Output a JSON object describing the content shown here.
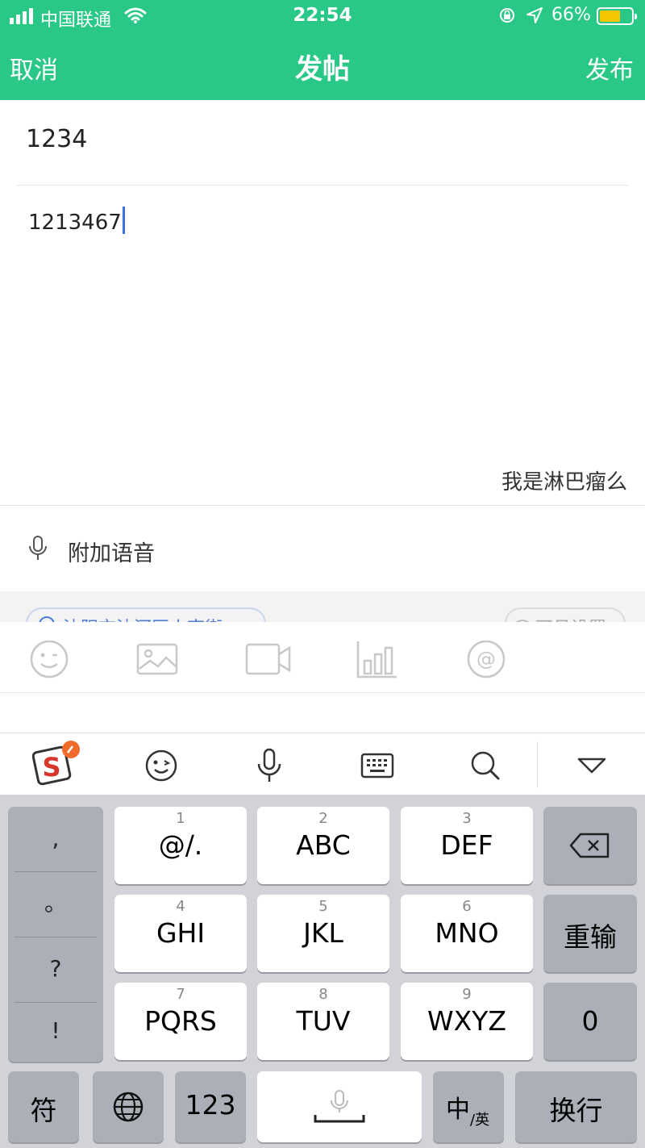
{
  "status_bar": {
    "carrier": "中国联通",
    "time": "22:54",
    "battery_percent": "66%",
    "battery_level": 0.66,
    "icons": [
      "signal-icon",
      "wifi-icon",
      "orientation-lock-icon",
      "location-arrow-icon",
      "battery-icon"
    ]
  },
  "nav": {
    "cancel": "取消",
    "title": "发帖",
    "publish": "发布"
  },
  "post": {
    "title_value": "1234",
    "body_value": "1213467"
  },
  "suggestion": "我是淋巴瘤么",
  "voice": {
    "label": "附加语音"
  },
  "location_pill": "沈阳市沈河区小南街",
  "visibility_pill": "可见设置",
  "toolbar_icons": [
    "emoji-icon",
    "image-icon",
    "video-icon",
    "chart-icon",
    "at-mention-icon"
  ],
  "keyboard": {
    "toolbar_icons": [
      "sogou-logo-icon",
      "emoji-icon",
      "microphone-icon",
      "keyboard-icon",
      "search-icon",
      "collapse-keyboard-icon"
    ],
    "punctuation": [
      ",",
      "。",
      "?",
      "!"
    ],
    "keys": [
      {
        "num": "1",
        "label": "@/."
      },
      {
        "num": "2",
        "label": "ABC"
      },
      {
        "num": "3",
        "label": "DEF"
      },
      {
        "num": "4",
        "label": "GHI"
      },
      {
        "num": "5",
        "label": "JKL"
      },
      {
        "num": "6",
        "label": "MNO"
      },
      {
        "num": "7",
        "label": "PQRS"
      },
      {
        "num": "8",
        "label": "TUV"
      },
      {
        "num": "9",
        "label": "WXYZ"
      }
    ],
    "reinput": "重输",
    "zero": "0",
    "symbols": "符",
    "num_mode": "123",
    "lang_main": "中",
    "lang_sub": "/英",
    "newline": "换行"
  },
  "colors": {
    "brand_green": "#2ac887",
    "caret_blue": "#3a6fe8",
    "battery_yellow": "#f5c600"
  }
}
